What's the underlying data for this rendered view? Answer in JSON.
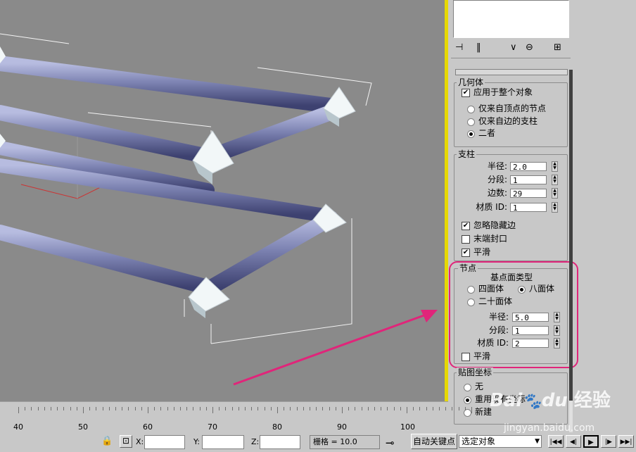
{
  "geometry": {
    "title": "几何体",
    "apply_whole": "应用于整个对象",
    "only_vertex": "仅来自顶点的节点",
    "only_edge": "仅来自边的支柱",
    "both": "二者"
  },
  "struts": {
    "title": "支柱",
    "radius_label": "半径:",
    "radius": "2.0",
    "segments_label": "分段:",
    "segments": "1",
    "sides_label": "边数:",
    "sides": "29",
    "matid_label": "材质 ID:",
    "matid": "1",
    "ignore_hidden": "忽略隐藏边",
    "end_caps": "末端封口",
    "smooth": "平滑"
  },
  "joints": {
    "title": "节点",
    "type_title": "基点面类型",
    "tetra": "四面体",
    "octa": "八面体",
    "icosa": "二十面体",
    "radius_label": "半径:",
    "radius": "5.0",
    "segments_label": "分段:",
    "segments": "1",
    "matid_label": "材质 ID:",
    "matid": "2",
    "smooth": "平滑"
  },
  "mapping": {
    "title": "贴图坐标",
    "none": "无",
    "reuse": "重用现有坐标",
    "new": "新建"
  },
  "timeline": {
    "labels": [
      "40",
      "50",
      "60",
      "70",
      "80",
      "90",
      "100"
    ]
  },
  "status": {
    "x_label": "X:",
    "y_label": "Y:",
    "z_label": "Z:",
    "grid": "栅格 = 10.0",
    "auto_key": "自动关键点",
    "selection": "选定对象"
  },
  "watermark": {
    "brand": "Bai",
    "du": "du",
    "jingyan": "经验",
    "url": "jingyan.baidu.com"
  },
  "colors": {
    "viewport": "#8a8a8a",
    "tube": "#8187b4",
    "highlight": "#e0257a",
    "active_border": "#e6d800"
  }
}
